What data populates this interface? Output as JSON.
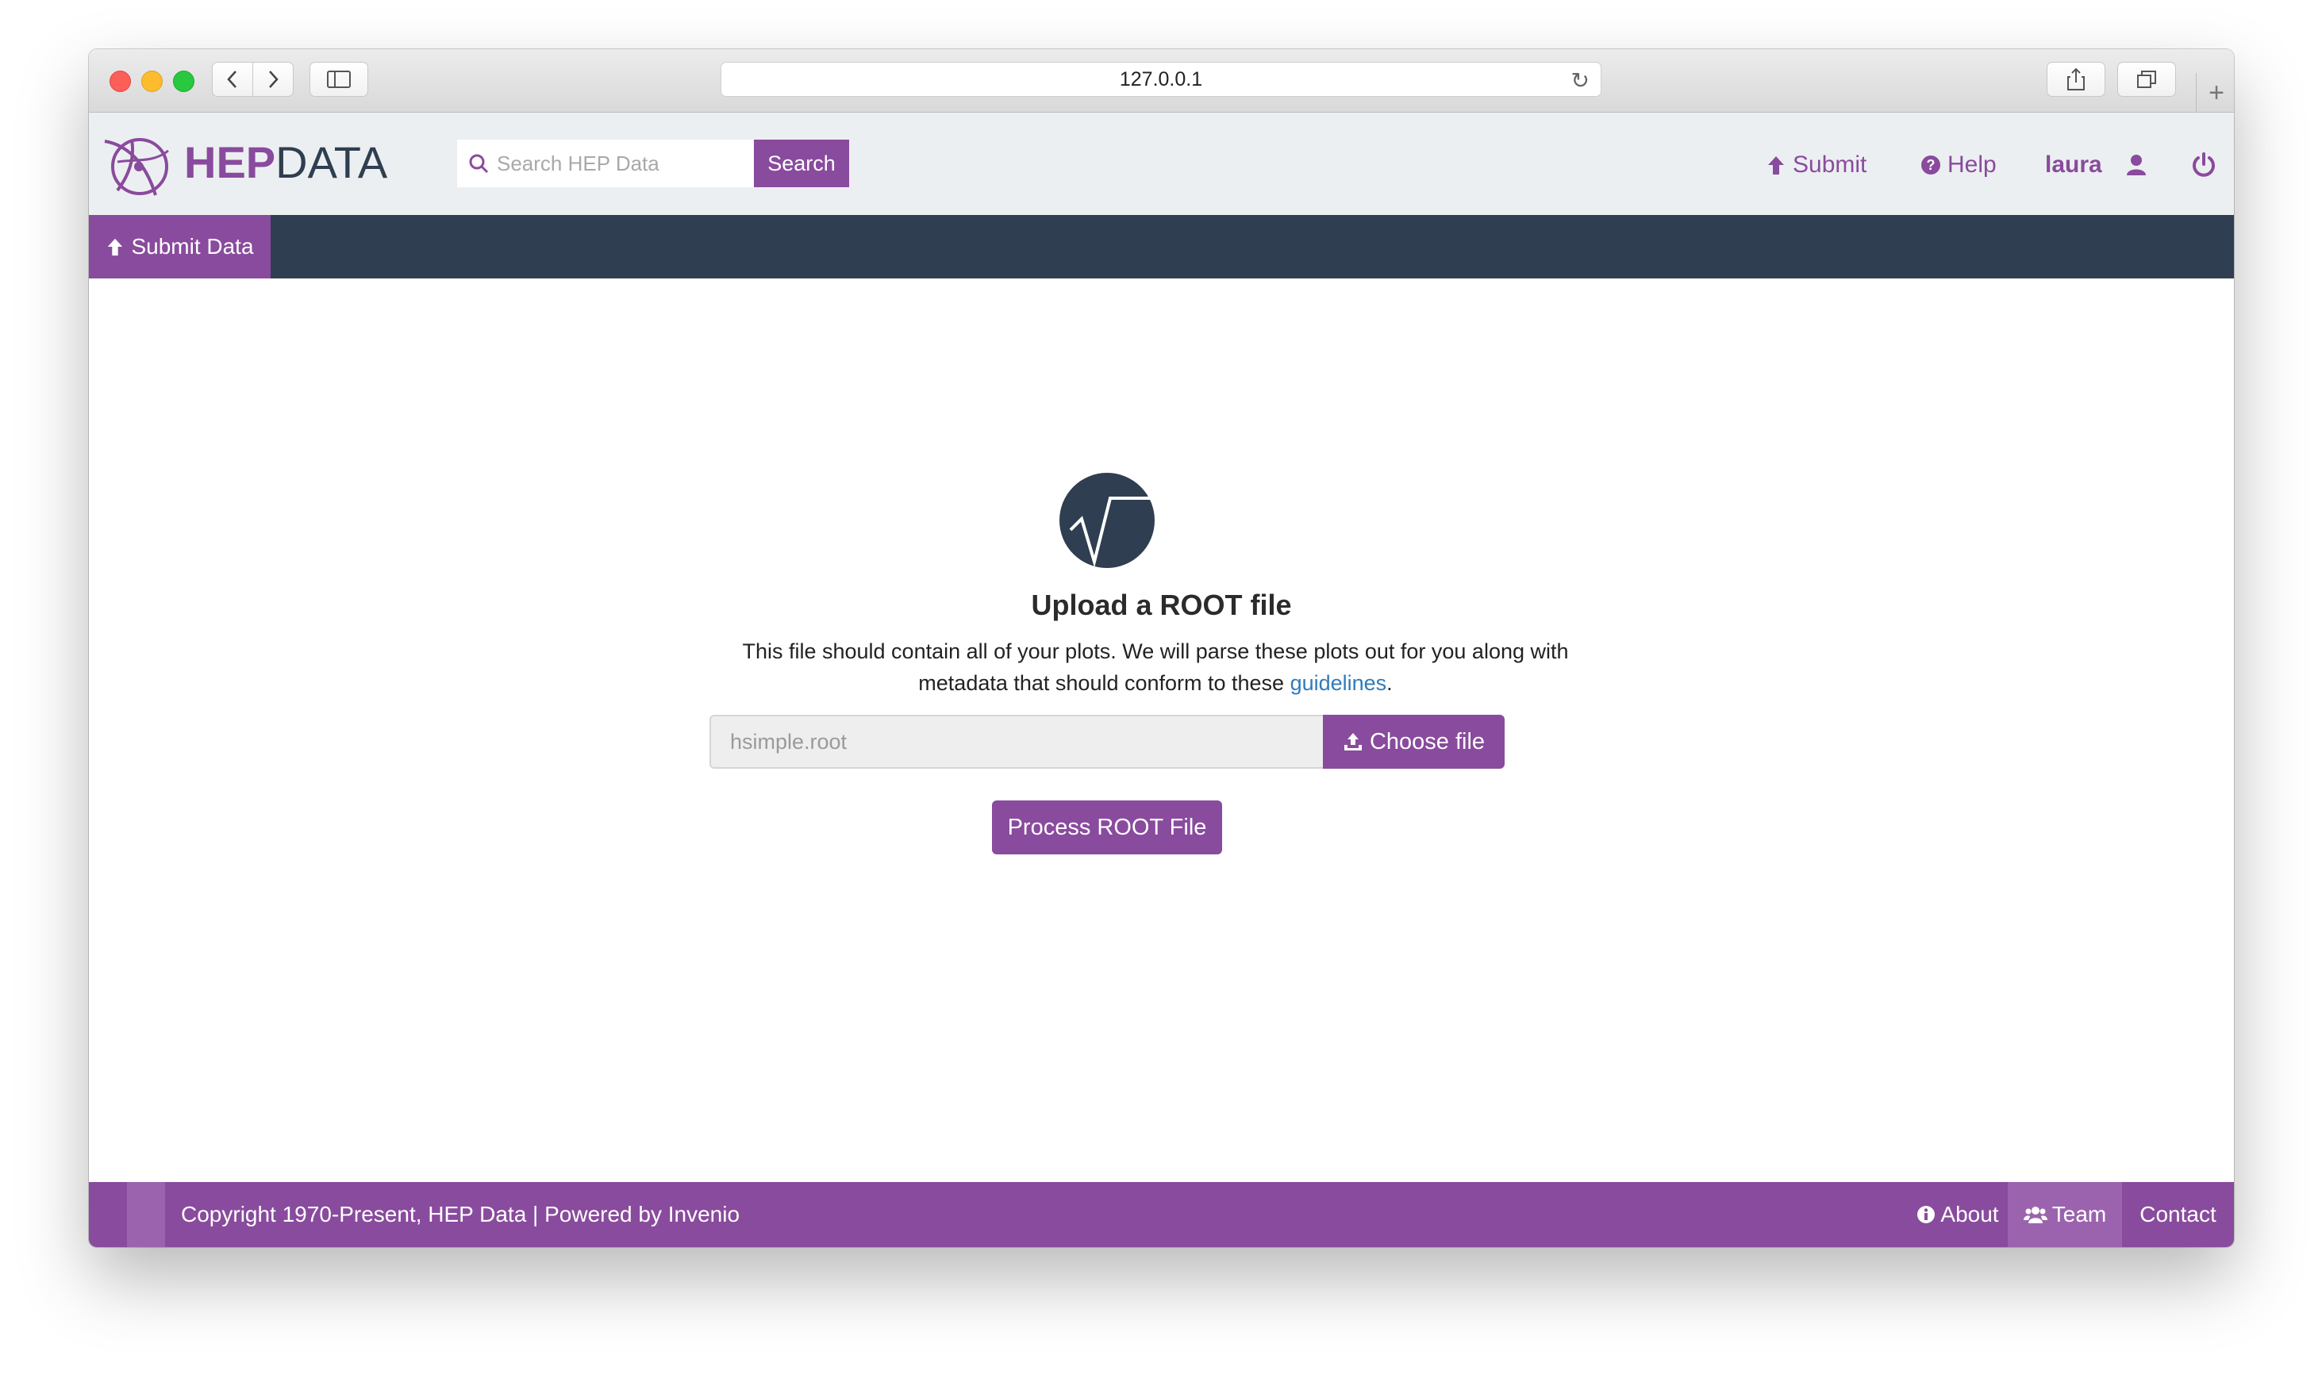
{
  "browser": {
    "url": "127.0.0.1",
    "icons": {
      "back": "chevron-left-icon",
      "forward": "chevron-right-icon",
      "sidebar": "sidebar-icon",
      "reload": "reload-icon",
      "share": "share-icon",
      "tabs": "tabs-icon",
      "new_tab": "plus-icon"
    }
  },
  "header": {
    "logo_hep": "HEP",
    "logo_data": "DATA",
    "search_placeholder": "Search HEP Data",
    "search_button": "Search",
    "nav": {
      "submit": "Submit",
      "help": "Help",
      "user": "laura"
    }
  },
  "subnav": {
    "submit_data": "Submit Data"
  },
  "upload": {
    "title": "Upload a ROOT file",
    "desc_part1": "This file should contain all of your plots. We will parse these plots out for you along with metadata that should conform to these ",
    "desc_link": "guidelines",
    "desc_end": ".",
    "file_value": "hsimple.root",
    "choose_button": "Choose file",
    "process_button": "Process ROOT File"
  },
  "footer": {
    "copyright": "Copyright 1970-Present, HEP Data | Powered by Invenio",
    "about": "About",
    "team": "Team",
    "contact": "Contact"
  },
  "colors": {
    "brand_purple": "#894b9d",
    "navy": "#2f3e50",
    "link_blue": "#2f7bbd",
    "header_bg": "#eceff1"
  }
}
